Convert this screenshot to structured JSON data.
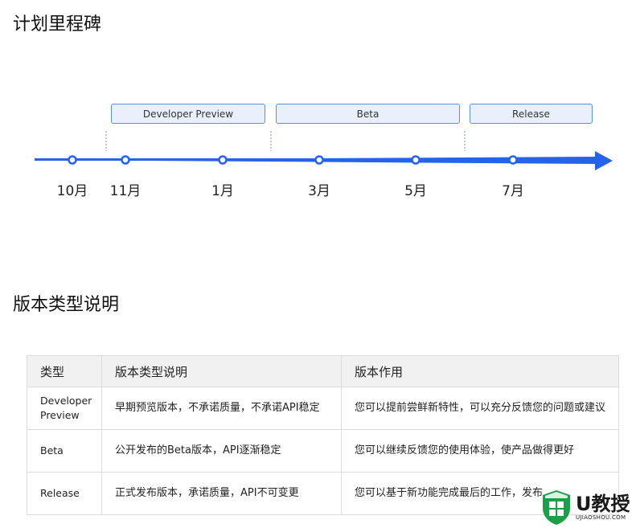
{
  "milestones": {
    "title": "计划里程碑",
    "phases": [
      {
        "label": "Developer Preview"
      },
      {
        "label": "Beta"
      },
      {
        "label": "Release"
      }
    ],
    "months": [
      "10月",
      "11月",
      "1月",
      "3月",
      "5月",
      "7月"
    ],
    "accent_color": "#2563eb"
  },
  "types": {
    "title": "版本类型说明",
    "columns": [
      "类型",
      "版本类型说明",
      "版本作用"
    ],
    "rows": [
      {
        "type": "Developer Preview",
        "desc": "早期预览版本，不承诺质量，不承诺API稳定",
        "role": "您可以提前尝鲜新特性，可以充分反馈您的问题或建议"
      },
      {
        "type": "Beta",
        "desc": "公开发布的Beta版本，API逐渐稳定",
        "role": "您可以继续反馈您的使用体验，使产品做得更好"
      },
      {
        "type": "Release",
        "desc": "正式发布版本，承诺质量，API不可变更",
        "role": "您可以基于新功能完成最后的工作，发布"
      }
    ]
  },
  "watermark": {
    "logo_text": "U教授",
    "url_text": "UJIAOSHOU.COM",
    "icon": "windows-shield-icon",
    "color": "#1e9e4a"
  }
}
